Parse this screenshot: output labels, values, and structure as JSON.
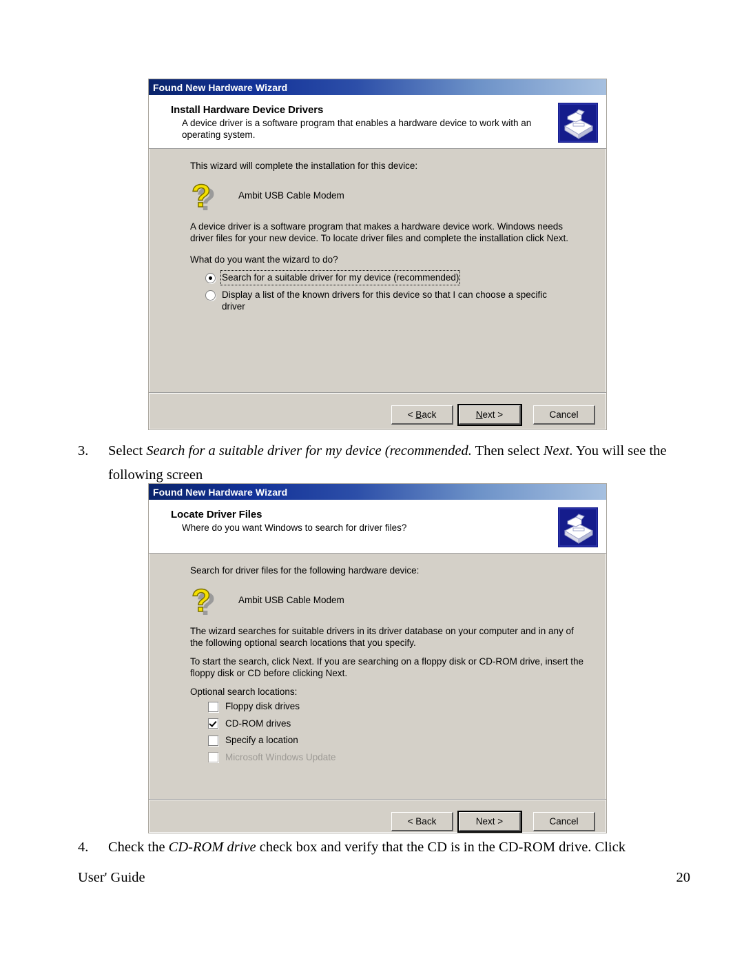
{
  "page": {
    "footer_left": "User' Guide",
    "footer_page_number": "20"
  },
  "dialog1": {
    "titlebar": "Found New Hardware Wizard",
    "header_title": "Install Hardware Device Drivers",
    "header_subtitle": "A device driver is a software program that enables a hardware device to work with an operating system.",
    "intro": "This wizard will complete the installation for this device:",
    "device_name": "Ambit USB Cable Modem",
    "paragraph": "A device driver is a software program that makes a hardware device work. Windows needs driver files for your new device. To locate driver files and complete the installation click Next.",
    "question": "What do you want the wizard to do?",
    "options": [
      {
        "label": "Search for a suitable driver for my device (recommended)",
        "checked": true,
        "focused": true
      },
      {
        "label": "Display a list of the known drivers for this device so that I can choose a specific driver",
        "checked": false,
        "focused": false
      }
    ],
    "buttons": {
      "back_pre": "< ",
      "back_acc": "B",
      "back_post": "ack",
      "next_acc": "N",
      "next_post": "ext >",
      "cancel": "Cancel"
    }
  },
  "dialog2": {
    "titlebar": "Found New Hardware Wizard",
    "header_title": "Locate Driver Files",
    "header_subtitle": "Where do you want Windows to search for driver files?",
    "intro": "Search for driver files for the following hardware device:",
    "device_name": "Ambit USB Cable Modem",
    "paragraph1": "The wizard searches for suitable drivers in its driver database on your computer and in any of the following optional search locations that you specify.",
    "paragraph2": "To start the search, click Next. If you are searching on a floppy disk or CD-ROM drive, insert the floppy disk or CD before clicking Next.",
    "locations_label": "Optional search locations:",
    "checkboxes": [
      {
        "label": "Floppy disk drives",
        "checked": false,
        "disabled": false
      },
      {
        "label": "CD-ROM drives",
        "checked": true,
        "disabled": false
      },
      {
        "label": "Specify a location",
        "checked": false,
        "disabled": false
      },
      {
        "label": "Microsoft Windows Update",
        "checked": false,
        "disabled": true
      }
    ],
    "buttons": {
      "back": "< Back",
      "next": "Next >",
      "cancel": "Cancel"
    }
  },
  "steps": {
    "step3_number": "3.",
    "step3_part1": "Select ",
    "step3_italic1": "Search for a suitable driver for my device (recommended.",
    "step3_part2": "  Then select ",
    "step3_italic2": "Next",
    "step3_part3": ".  You will see the following screen",
    "step4_number": "4.",
    "step4_part1": "Check the ",
    "step4_italic1": "CD-ROM drive",
    "step4_part2": " check box and verify that the CD is in the CD-ROM drive.  Click"
  },
  "colors": {
    "titlebar_start": "#0a246a",
    "titlebar_end": "#a6c0e0",
    "dialog_face": "#d4d0c8",
    "icon_bg": "#151c8c",
    "question_yellow": "#f5e000"
  }
}
